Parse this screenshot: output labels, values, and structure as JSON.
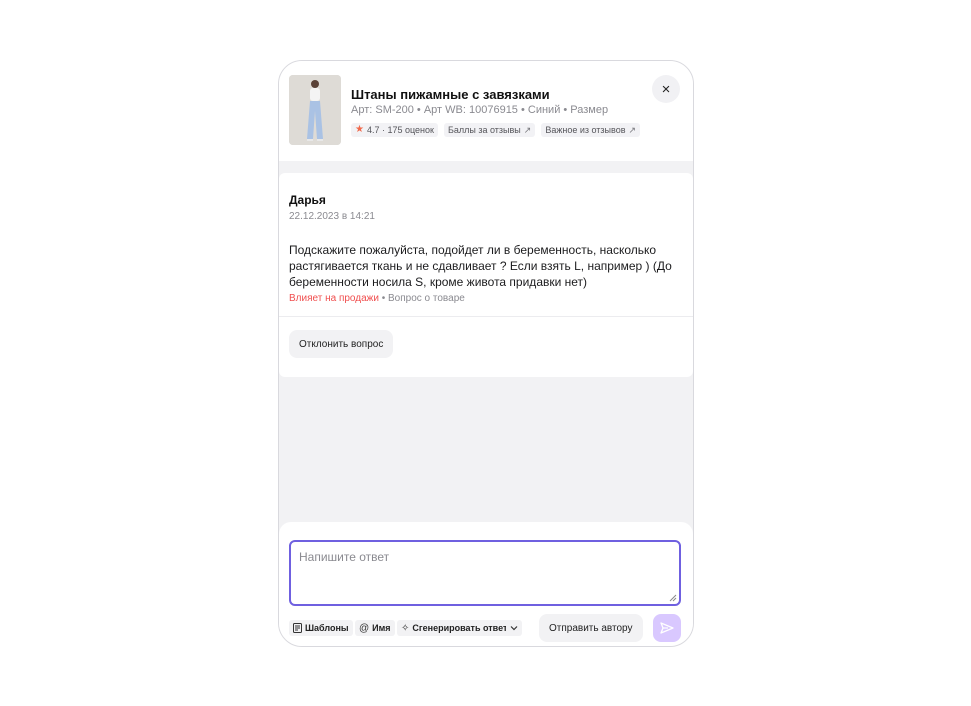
{
  "product": {
    "title": "Штаны пижамные с завязками",
    "meta": "Арт: SM-200 • Арт WB: 10076915 • Синий • Размер",
    "rating_chip": "4.7 · 175 оценок",
    "reviews_points_chip": "Баллы за отзывы",
    "important_reviews_chip": "Важное из отзывов",
    "close_label": "×"
  },
  "question": {
    "author": "Дарья",
    "date": "22.12.2023 в 14:21",
    "text": "Подскажите пожалуйста, подойдет ли в беременность, насколько растягивается ткань и не сдавливает ? Если взять L, например ) (До беременности носила S, кроме живота придавки нет)",
    "impact_tag": "Влияет на продажи",
    "type_tag": " • Вопрос о товаре",
    "reject_label": "Отклонить вопрос"
  },
  "reply": {
    "placeholder": "Напишите ответ",
    "value": "",
    "templates_label": "Шаблоны",
    "name_label": "Имя",
    "generate_label": "Сгенерировать ответ",
    "send_author_label": "Отправить автору"
  },
  "icons": {
    "star": "star-icon",
    "arrow": "external-arrow-icon",
    "close": "close-icon",
    "templates": "document-icon",
    "name": "at-icon",
    "generate": "sparkle-icon",
    "chevron": "chevron-down-icon",
    "send": "send-icon"
  },
  "colors": {
    "accent": "#6f60e0",
    "send_button": "#d9c8ff",
    "warning": "#f04e4e",
    "rating_star": "#f0694b"
  }
}
